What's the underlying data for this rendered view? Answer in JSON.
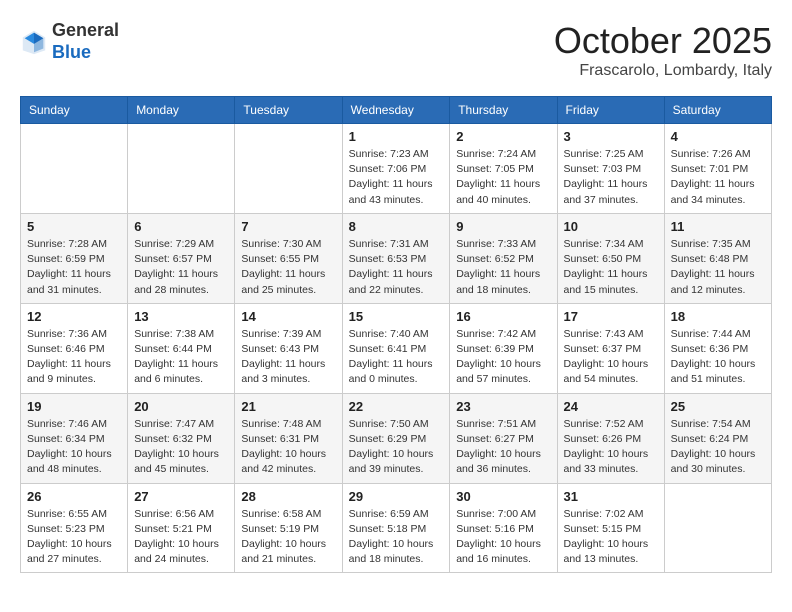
{
  "header": {
    "logo_general": "General",
    "logo_blue": "Blue",
    "month_title": "October 2025",
    "location": "Frascarolo, Lombardy, Italy"
  },
  "days_of_week": [
    "Sunday",
    "Monday",
    "Tuesday",
    "Wednesday",
    "Thursday",
    "Friday",
    "Saturday"
  ],
  "weeks": [
    [
      {
        "day": "",
        "info": ""
      },
      {
        "day": "",
        "info": ""
      },
      {
        "day": "",
        "info": ""
      },
      {
        "day": "1",
        "info": "Sunrise: 7:23 AM\nSunset: 7:06 PM\nDaylight: 11 hours\nand 43 minutes."
      },
      {
        "day": "2",
        "info": "Sunrise: 7:24 AM\nSunset: 7:05 PM\nDaylight: 11 hours\nand 40 minutes."
      },
      {
        "day": "3",
        "info": "Sunrise: 7:25 AM\nSunset: 7:03 PM\nDaylight: 11 hours\nand 37 minutes."
      },
      {
        "day": "4",
        "info": "Sunrise: 7:26 AM\nSunset: 7:01 PM\nDaylight: 11 hours\nand 34 minutes."
      }
    ],
    [
      {
        "day": "5",
        "info": "Sunrise: 7:28 AM\nSunset: 6:59 PM\nDaylight: 11 hours\nand 31 minutes."
      },
      {
        "day": "6",
        "info": "Sunrise: 7:29 AM\nSunset: 6:57 PM\nDaylight: 11 hours\nand 28 minutes."
      },
      {
        "day": "7",
        "info": "Sunrise: 7:30 AM\nSunset: 6:55 PM\nDaylight: 11 hours\nand 25 minutes."
      },
      {
        "day": "8",
        "info": "Sunrise: 7:31 AM\nSunset: 6:53 PM\nDaylight: 11 hours\nand 22 minutes."
      },
      {
        "day": "9",
        "info": "Sunrise: 7:33 AM\nSunset: 6:52 PM\nDaylight: 11 hours\nand 18 minutes."
      },
      {
        "day": "10",
        "info": "Sunrise: 7:34 AM\nSunset: 6:50 PM\nDaylight: 11 hours\nand 15 minutes."
      },
      {
        "day": "11",
        "info": "Sunrise: 7:35 AM\nSunset: 6:48 PM\nDaylight: 11 hours\nand 12 minutes."
      }
    ],
    [
      {
        "day": "12",
        "info": "Sunrise: 7:36 AM\nSunset: 6:46 PM\nDaylight: 11 hours\nand 9 minutes."
      },
      {
        "day": "13",
        "info": "Sunrise: 7:38 AM\nSunset: 6:44 PM\nDaylight: 11 hours\nand 6 minutes."
      },
      {
        "day": "14",
        "info": "Sunrise: 7:39 AM\nSunset: 6:43 PM\nDaylight: 11 hours\nand 3 minutes."
      },
      {
        "day": "15",
        "info": "Sunrise: 7:40 AM\nSunset: 6:41 PM\nDaylight: 11 hours\nand 0 minutes."
      },
      {
        "day": "16",
        "info": "Sunrise: 7:42 AM\nSunset: 6:39 PM\nDaylight: 10 hours\nand 57 minutes."
      },
      {
        "day": "17",
        "info": "Sunrise: 7:43 AM\nSunset: 6:37 PM\nDaylight: 10 hours\nand 54 minutes."
      },
      {
        "day": "18",
        "info": "Sunrise: 7:44 AM\nSunset: 6:36 PM\nDaylight: 10 hours\nand 51 minutes."
      }
    ],
    [
      {
        "day": "19",
        "info": "Sunrise: 7:46 AM\nSunset: 6:34 PM\nDaylight: 10 hours\nand 48 minutes."
      },
      {
        "day": "20",
        "info": "Sunrise: 7:47 AM\nSunset: 6:32 PM\nDaylight: 10 hours\nand 45 minutes."
      },
      {
        "day": "21",
        "info": "Sunrise: 7:48 AM\nSunset: 6:31 PM\nDaylight: 10 hours\nand 42 minutes."
      },
      {
        "day": "22",
        "info": "Sunrise: 7:50 AM\nSunset: 6:29 PM\nDaylight: 10 hours\nand 39 minutes."
      },
      {
        "day": "23",
        "info": "Sunrise: 7:51 AM\nSunset: 6:27 PM\nDaylight: 10 hours\nand 36 minutes."
      },
      {
        "day": "24",
        "info": "Sunrise: 7:52 AM\nSunset: 6:26 PM\nDaylight: 10 hours\nand 33 minutes."
      },
      {
        "day": "25",
        "info": "Sunrise: 7:54 AM\nSunset: 6:24 PM\nDaylight: 10 hours\nand 30 minutes."
      }
    ],
    [
      {
        "day": "26",
        "info": "Sunrise: 6:55 AM\nSunset: 5:23 PM\nDaylight: 10 hours\nand 27 minutes."
      },
      {
        "day": "27",
        "info": "Sunrise: 6:56 AM\nSunset: 5:21 PM\nDaylight: 10 hours\nand 24 minutes."
      },
      {
        "day": "28",
        "info": "Sunrise: 6:58 AM\nSunset: 5:19 PM\nDaylight: 10 hours\nand 21 minutes."
      },
      {
        "day": "29",
        "info": "Sunrise: 6:59 AM\nSunset: 5:18 PM\nDaylight: 10 hours\nand 18 minutes."
      },
      {
        "day": "30",
        "info": "Sunrise: 7:00 AM\nSunset: 5:16 PM\nDaylight: 10 hours\nand 16 minutes."
      },
      {
        "day": "31",
        "info": "Sunrise: 7:02 AM\nSunset: 5:15 PM\nDaylight: 10 hours\nand 13 minutes."
      },
      {
        "day": "",
        "info": ""
      }
    ]
  ]
}
